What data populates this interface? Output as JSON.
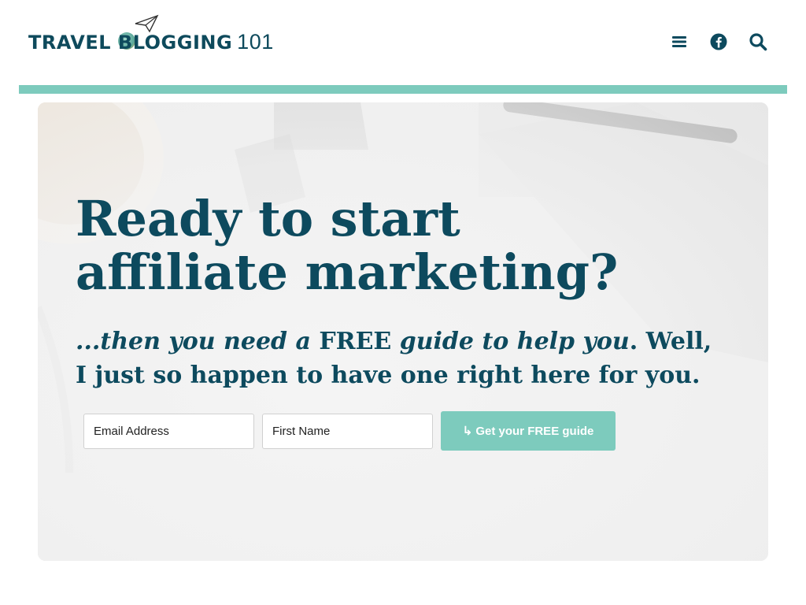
{
  "header": {
    "logo_text": "TRAVEL BLOGGING",
    "logo_number": "101",
    "icons": [
      "menu-icon",
      "facebook-icon",
      "search-icon"
    ]
  },
  "colors": {
    "brand_dark": "#0d4a5e",
    "accent_teal": "#7dcbbd"
  },
  "hero": {
    "headline": "Ready to start affiliate marketing?",
    "sub_1": "...then you need a",
    "sub_2": " FREE ",
    "sub_3": "guide to help you",
    "sub_4": ". Well, I just so happen to have one right here for you.",
    "form": {
      "email_placeholder": "Email Address",
      "first_name_placeholder": "First Name",
      "submit_label": "↳ Get your FREE guide"
    }
  }
}
